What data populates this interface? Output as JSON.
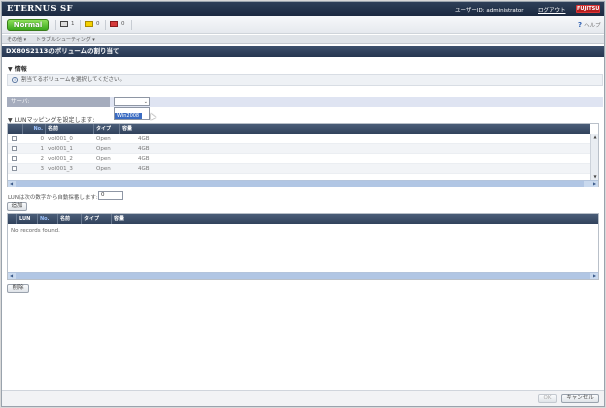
{
  "header": {
    "app_title": "ETERNUS SF",
    "user_label": "ユーザーID: administrator",
    "logout_label": "ログアウト",
    "vendor_logo": "FUJITSU"
  },
  "status": {
    "normal_label": "Normal",
    "items": [
      {
        "icon": "error-icon",
        "count": "1",
        "color": "#444444"
      },
      {
        "icon": "warning-icon",
        "count": "0",
        "color": "#e0b400"
      },
      {
        "icon": "maintenance-icon",
        "count": "0",
        "color": "#c22a2a"
      }
    ],
    "help_label": "ヘルプ"
  },
  "menu": {
    "items": [
      "その他 ▾",
      "トラブルシューティング ▾"
    ]
  },
  "page": {
    "title": "DX80S2113のボリュームの割り当て"
  },
  "info": {
    "heading": "▼ 情報",
    "message": "割当てるボリュームを選択してください。"
  },
  "server": {
    "label": "サーバ:",
    "selected_value": "",
    "dropdown_option": "Win2008"
  },
  "lun_mapping": {
    "heading": "▼ LUNマッピングを設定します:",
    "columns": [
      "No.",
      "名前",
      "タイプ",
      "容量"
    ],
    "rows": [
      {
        "no": "0",
        "name": "vol001_0",
        "type": "Open",
        "size": "4GB"
      },
      {
        "no": "1",
        "name": "vol001_1",
        "type": "Open",
        "size": "4GB"
      },
      {
        "no": "2",
        "name": "vol001_2",
        "type": "Open",
        "size": "4GB"
      },
      {
        "no": "3",
        "name": "vol001_3",
        "type": "Open",
        "size": "4GB"
      }
    ],
    "lun_start_label": "LUNは次の数字から自動採番します:",
    "lun_start_value": "0",
    "add_button": "追加"
  },
  "assigned": {
    "columns": [
      "LUN",
      "No.",
      "名前",
      "タイプ",
      "容量"
    ],
    "empty_message": "No records found.",
    "delete_button": "削除"
  },
  "footer": {
    "ok_button": "OK",
    "cancel_button": "キャンセル"
  }
}
